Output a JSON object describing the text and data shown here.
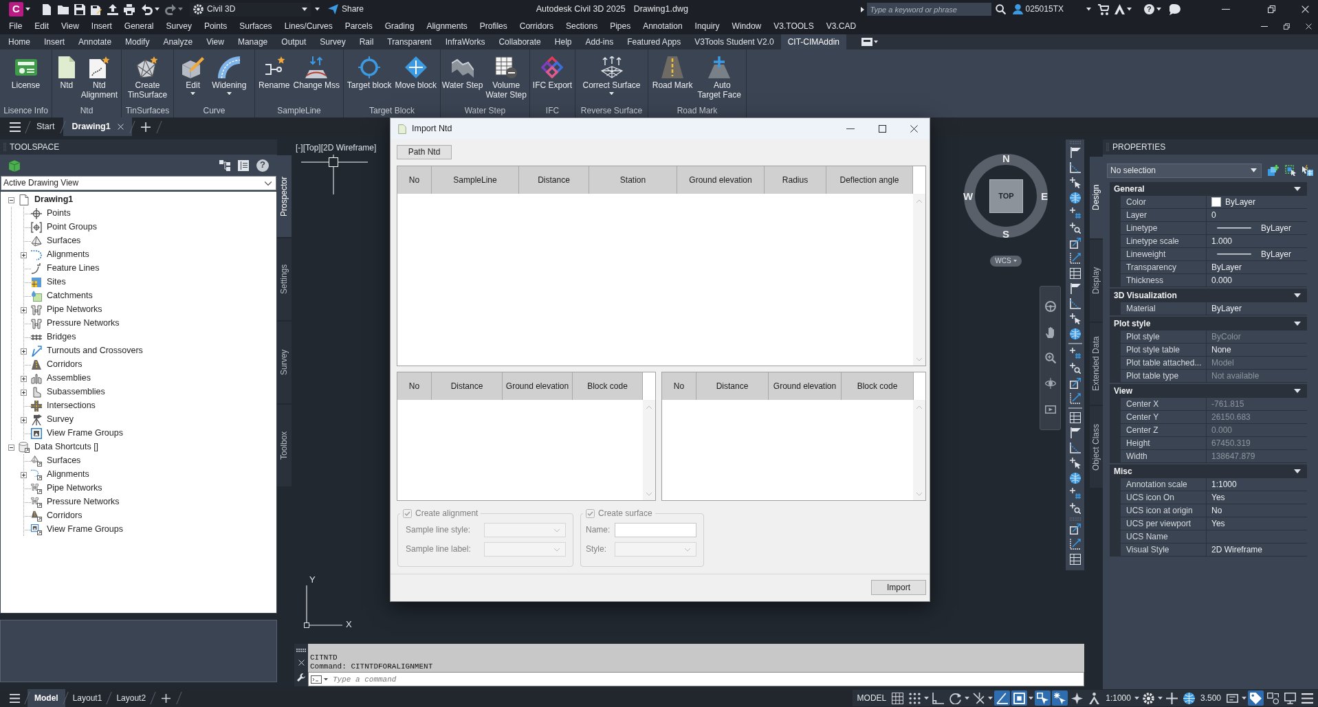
{
  "title_bar": {
    "logo_letter": "C",
    "workspace": "Civil 3D",
    "share": "Share",
    "app_title": "Autodesk Civil 3D 2025",
    "file_name": "Drawing1.dwg",
    "search": {
      "placeholder": "Type a keyword or phrase"
    },
    "user": "025015TX",
    "help_glyph": "?"
  },
  "menu_bar": [
    "File",
    "Edit",
    "View",
    "Insert",
    "General",
    "Survey",
    "Points",
    "Surfaces",
    "Lines/Curves",
    "Parcels",
    "Grading",
    "Alignments",
    "Profiles",
    "Corridors",
    "Sections",
    "Pipes",
    "Annotation",
    "Inquiry",
    "Window",
    "V3.TOOLS",
    "V3.CAD"
  ],
  "ribbon_tabs": [
    {
      "label": "Home",
      "selected": false
    },
    {
      "label": "Insert",
      "selected": false
    },
    {
      "label": "Annotate",
      "selected": false
    },
    {
      "label": "Modify",
      "selected": false
    },
    {
      "label": "Analyze",
      "selected": false
    },
    {
      "label": "View",
      "selected": false
    },
    {
      "label": "Manage",
      "selected": false
    },
    {
      "label": "Output",
      "selected": false
    },
    {
      "label": "Survey",
      "selected": false
    },
    {
      "label": "Rail",
      "selected": false
    },
    {
      "label": "Transparent",
      "selected": false
    },
    {
      "label": "InfraWorks",
      "selected": false
    },
    {
      "label": "Collaborate",
      "selected": false
    },
    {
      "label": "Help",
      "selected": false
    },
    {
      "label": "Add-ins",
      "selected": false
    },
    {
      "label": "Featured Apps",
      "selected": false
    },
    {
      "label": "V3Tools Student V2.0",
      "selected": false
    },
    {
      "label": "CIT-CIMAddin",
      "selected": true
    }
  ],
  "ribbon_panels": [
    {
      "title": "Lisence Info",
      "buttons": [
        {
          "label": "License",
          "dropdown": false
        }
      ]
    },
    {
      "title": "Ntd",
      "buttons": [
        {
          "label": "Ntd",
          "dropdown": false
        },
        {
          "label": "Ntd Alignment",
          "dropdown": false
        }
      ]
    },
    {
      "title": "TinSurfaces",
      "buttons": [
        {
          "label": "Create TinSurface",
          "dropdown": false
        }
      ]
    },
    {
      "title": "Curve",
      "buttons": [
        {
          "label": "Edit",
          "dropdown": true
        },
        {
          "label": "Widening",
          "dropdown": true
        }
      ]
    },
    {
      "title": "SampleLine",
      "buttons": [
        {
          "label": "Rename",
          "dropdown": false
        },
        {
          "label": "Change Mss",
          "dropdown": false
        }
      ]
    },
    {
      "title": "Target Block",
      "buttons": [
        {
          "label": "Target block",
          "dropdown": false
        },
        {
          "label": "Move block",
          "dropdown": false
        }
      ]
    },
    {
      "title": "Water Step",
      "buttons": [
        {
          "label": "Water Step",
          "dropdown": false
        },
        {
          "label": "Volume Water Step",
          "dropdown": false
        }
      ]
    },
    {
      "title": "IFC",
      "buttons": [
        {
          "label": "IFC Export",
          "dropdown": false
        }
      ]
    },
    {
      "title": "Reverse Surface",
      "buttons": [
        {
          "label": "Correct Surface",
          "dropdown": true
        }
      ]
    },
    {
      "title": "Road Mark",
      "buttons": [
        {
          "label": "Road Mark",
          "dropdown": false
        },
        {
          "label": "Auto Target Face",
          "dropdown": false
        }
      ]
    }
  ],
  "file_tabs": [
    {
      "label": "Start",
      "selected": false,
      "closable": false
    },
    {
      "label": "Drawing1",
      "selected": true,
      "closable": true
    }
  ],
  "toolspace": {
    "title": "TOOLSPACE",
    "help_glyph": "?",
    "view": "Active Drawing View",
    "tree": [
      {
        "label": "Drawing1",
        "current": true,
        "kind": "branch",
        "expanded": true,
        "children": [
          {
            "label": "Points",
            "kind": "leaf"
          },
          {
            "label": "Point Groups",
            "kind": "leaf"
          },
          {
            "label": "Surfaces",
            "kind": "leaf"
          },
          {
            "label": "Alignments",
            "kind": "branch",
            "expanded": false
          },
          {
            "label": "Feature Lines",
            "kind": "leaf"
          },
          {
            "label": "Sites",
            "kind": "leaf"
          },
          {
            "label": "Catchments",
            "kind": "leaf"
          },
          {
            "label": "Pipe Networks",
            "kind": "branch",
            "expanded": false
          },
          {
            "label": "Pressure Networks",
            "kind": "leaf"
          },
          {
            "label": "Bridges",
            "kind": "leaf"
          },
          {
            "label": "Turnouts and Crossovers",
            "kind": "branch",
            "expanded": false
          },
          {
            "label": "Corridors",
            "kind": "leaf"
          },
          {
            "label": "Assemblies",
            "kind": "branch",
            "expanded": false
          },
          {
            "label": "Subassemblies",
            "kind": "branch",
            "expanded": false
          },
          {
            "label": "Intersections",
            "kind": "leaf"
          },
          {
            "label": "Survey",
            "kind": "branch",
            "expanded": false
          },
          {
            "label": "View Frame Groups",
            "kind": "leaf"
          }
        ]
      },
      {
        "label": "Data Shortcuts []",
        "current": false,
        "kind": "branch",
        "expanded": true,
        "children": [
          {
            "label": "Surfaces",
            "kind": "leaf"
          },
          {
            "label": "Alignments",
            "kind": "branch",
            "expanded": false
          },
          {
            "label": "Pipe Networks",
            "kind": "leaf"
          },
          {
            "label": "Pressure Networks",
            "kind": "leaf"
          },
          {
            "label": "Corridors",
            "kind": "leaf"
          },
          {
            "label": "View Frame Groups",
            "kind": "leaf"
          }
        ]
      }
    ],
    "side_tabs": [
      {
        "label": "Prospector",
        "selected": true
      },
      {
        "label": "Settings",
        "selected": false
      },
      {
        "label": "Survey",
        "selected": false
      },
      {
        "label": "Toolbox",
        "selected": false
      }
    ]
  },
  "viewport": {
    "controls": [
      "[-]",
      "[Top]",
      "[2D Wireframe]"
    ],
    "viewcube": {
      "north": "N",
      "south": "S",
      "east": "E",
      "west": "W",
      "face": "TOP",
      "coordinate_system": "WCS"
    },
    "ucs": {
      "x_label": "X",
      "y_label": "Y"
    }
  },
  "dialog": {
    "title": "Import Ntd",
    "path_button": "Path Ntd",
    "main_table": {
      "columns": [
        "No",
        "SampleLine",
        "Distance",
        "Station",
        "Ground elevation",
        "Radius",
        "Deflection angle"
      ]
    },
    "left_table": {
      "columns": [
        "No",
        "Distance",
        "Ground elevation",
        "Block code"
      ]
    },
    "right_table": {
      "columns": [
        "No",
        "Distance",
        "Ground elevation",
        "Block code"
      ]
    },
    "option_groups": [
      {
        "label": "Create alignment",
        "checked": true,
        "disabled": true,
        "fields": [
          {
            "label": "Sample line style:",
            "kind": "select"
          },
          {
            "label": "Sample line label:",
            "kind": "select"
          }
        ]
      },
      {
        "label": "Create surface",
        "checked": true,
        "disabled": true,
        "fields": [
          {
            "label": "Name:",
            "kind": "text"
          },
          {
            "label": "Style:",
            "kind": "select"
          }
        ]
      }
    ],
    "import_button": "Import"
  },
  "command_line": {
    "history": [
      "CITNTD",
      "Command: CITNTDFORALIGNMENT"
    ],
    "placeholder": "Type a command"
  },
  "properties": {
    "title": "PROPERTIES",
    "selection": "No selection",
    "sections": [
      {
        "title": "General",
        "expanded": true,
        "rows": [
          {
            "label": "Color",
            "value": "ByLayer",
            "kind": "swatch",
            "disabled": false
          },
          {
            "label": "Layer",
            "value": "0",
            "kind": "text",
            "disabled": false
          },
          {
            "label": "Linetype",
            "value": "ByLayer",
            "kind": "line",
            "disabled": false
          },
          {
            "label": "Linetype scale",
            "value": "1.000",
            "kind": "text",
            "disabled": false
          },
          {
            "label": "Lineweight",
            "value": "ByLayer",
            "kind": "line",
            "disabled": false
          },
          {
            "label": "Transparency",
            "value": "ByLayer",
            "kind": "text",
            "disabled": false
          },
          {
            "label": "Thickness",
            "value": "0.000",
            "kind": "text",
            "disabled": false
          }
        ]
      },
      {
        "title": "3D Visualization",
        "expanded": true,
        "rows": [
          {
            "label": "Material",
            "value": "ByLayer",
            "kind": "text",
            "disabled": false
          }
        ]
      },
      {
        "title": "Plot style",
        "expanded": true,
        "rows": [
          {
            "label": "Plot style",
            "value": "ByColor",
            "kind": "text",
            "disabled": true
          },
          {
            "label": "Plot style table",
            "value": "None",
            "kind": "text",
            "disabled": false
          },
          {
            "label": "Plot table attached...",
            "value": "Model",
            "kind": "text",
            "disabled": true
          },
          {
            "label": "Plot table type",
            "value": "Not available",
            "kind": "text",
            "disabled": true
          }
        ]
      },
      {
        "title": "View",
        "expanded": true,
        "rows": [
          {
            "label": "Center X",
            "value": "-761.815",
            "kind": "text",
            "disabled": true
          },
          {
            "label": "Center Y",
            "value": "26150.683",
            "kind": "text",
            "disabled": true
          },
          {
            "label": "Center Z",
            "value": "0.000",
            "kind": "text",
            "disabled": true
          },
          {
            "label": "Height",
            "value": "67450.319",
            "kind": "text",
            "disabled": true
          },
          {
            "label": "Width",
            "value": "138647.879",
            "kind": "text",
            "disabled": true
          }
        ]
      },
      {
        "title": "Misc",
        "expanded": true,
        "rows": [
          {
            "label": "Annotation scale",
            "value": "1:1000",
            "kind": "text",
            "disabled": false
          },
          {
            "label": "UCS icon On",
            "value": "Yes",
            "kind": "text",
            "disabled": false
          },
          {
            "label": "UCS icon at origin",
            "value": "No",
            "kind": "text",
            "disabled": false
          },
          {
            "label": "UCS per viewport",
            "value": "Yes",
            "kind": "text",
            "disabled": false
          },
          {
            "label": "UCS Name",
            "kind": "text"
          },
          {
            "label": "Visual Style",
            "value": "2D Wireframe",
            "kind": "text",
            "disabled": false
          }
        ]
      }
    ],
    "side_tabs": [
      {
        "label": "Design",
        "selected": true
      },
      {
        "label": "Display",
        "selected": false
      },
      {
        "label": "Extended Data",
        "selected": false
      },
      {
        "label": "Object Class",
        "selected": false
      }
    ]
  },
  "status_bar": {
    "layout_tabs": [
      {
        "label": "Model",
        "selected": true
      },
      {
        "label": "Layout1",
        "selected": false
      },
      {
        "label": "Layout2",
        "selected": false
      }
    ],
    "items": [
      {
        "kind": "text",
        "text": "MODEL",
        "dropdown": false
      },
      {
        "kind": "tool",
        "on": false,
        "dropdown": false
      },
      {
        "kind": "tool",
        "on": false,
        "dropdown": true
      },
      {
        "kind": "tool",
        "on": false,
        "dropdown": false
      },
      {
        "kind": "tool",
        "on": false,
        "dropdown": true
      },
      {
        "kind": "tool",
        "on": false,
        "dropdown": true
      },
      {
        "kind": "tool",
        "on": true,
        "dropdown": false
      },
      {
        "kind": "tool",
        "on": true,
        "dropdown": true
      },
      {
        "kind": "tool",
        "on": true,
        "dropdown": false
      },
      {
        "kind": "tool",
        "on": true,
        "dropdown": false
      },
      {
        "kind": "tool",
        "on": false,
        "dropdown": false
      },
      {
        "kind": "tool",
        "on": false,
        "dropdown": false
      },
      {
        "kind": "text",
        "text": "1:1000",
        "dropdown": true
      },
      {
        "kind": "tool",
        "on": false,
        "dropdown": true
      },
      {
        "kind": "tool",
        "on": false,
        "dropdown": false
      },
      {
        "kind": "tool",
        "on": false,
        "dropdown": false
      },
      {
        "kind": "text",
        "text": "3.500",
        "dropdown": false
      },
      {
        "kind": "tool",
        "on": false,
        "dropdown": true
      },
      {
        "kind": "tool",
        "on": true,
        "dropdown": false
      },
      {
        "kind": "tool",
        "on": false,
        "dropdown": false
      },
      {
        "kind": "tool",
        "on": false,
        "dropdown": false
      },
      {
        "kind": "tool",
        "on": false,
        "dropdown": false
      }
    ]
  }
}
